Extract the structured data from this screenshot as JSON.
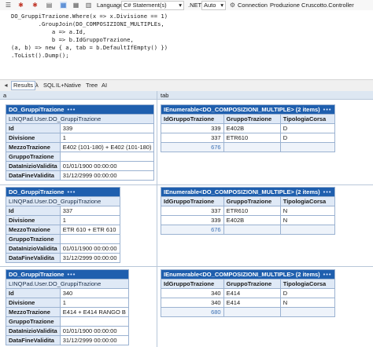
{
  "toolbar": {
    "language_label": "Language",
    "language_value": "C# Statement(s)",
    "dotnet_label": ".NET",
    "dotnet_value": "Auto",
    "connection_label": "Connection",
    "connection_value": "Produzione Cruscotto.Controller",
    "icons": [
      "bug-icon",
      "bug-icon",
      "grid-icon",
      "grid-icon",
      "grid-icon",
      "settings-icon"
    ]
  },
  "code_lines": [
    "DO_GruppiTrazione.Where(x => x.Divisione == 1)",
    "        .GroupJoin(DO_COMPOSIZIONI_MULTIPLEs,",
    "            a => a.Id,",
    "            b => b.IdGruppoTrazione,",
    "(a, b) => new { a, tab = b.DefaultIfEmpty() })",
    ".ToList().Dump();"
  ],
  "result_tabs": [
    "Results",
    "λ",
    "SQL",
    "IL+Native",
    "Tree",
    "AI"
  ],
  "grid": {
    "col_a": "a",
    "col_tab": "tab"
  },
  "rows": [
    {
      "a": {
        "caption": "DO_GruppiTrazione",
        "menu": "•••",
        "type": "LINQPad.User.DO_GruppiTrazione",
        "fields": [
          {
            "label": "Id",
            "value": "339"
          },
          {
            "label": "Divisione",
            "value": "1"
          },
          {
            "label": "MezzoTrazione",
            "value": "E402 (101-180) + E402 (101-180)"
          },
          {
            "label": "GruppoTrazione",
            "value": ""
          },
          {
            "label": "DataInizioValidita",
            "value": "01/01/1900 00:00:00"
          },
          {
            "label": "DataFineValidita",
            "value": "31/12/2999 00:00:00"
          }
        ]
      },
      "tab": {
        "caption": "IEnumerable<DO_COMPOSIZIONI_MULTIPLE> (2 items)",
        "menu": "•••",
        "columns": [
          "IdGruppoTrazione",
          "GruppoTrazione",
          "TipologiaCorsa"
        ],
        "items": [
          [
            "339",
            "E402B",
            "D"
          ],
          [
            "337",
            "ETR610",
            "D"
          ]
        ],
        "total": "676"
      }
    },
    {
      "a": {
        "caption": "DO_GruppiTrazione",
        "menu": "•••",
        "type": "LINQPad.User.DO_GruppiTrazione",
        "fields": [
          {
            "label": "Id",
            "value": "337"
          },
          {
            "label": "Divisione",
            "value": "1"
          },
          {
            "label": "MezzoTrazione",
            "value": "ETR 610 + ETR 610"
          },
          {
            "label": "GruppoTrazione",
            "value": ""
          },
          {
            "label": "DataInizioValidita",
            "value": "01/01/1900 00:00:00"
          },
          {
            "label": "DataFineValidita",
            "value": "31/12/2999 00:00:00"
          }
        ]
      },
      "tab": {
        "caption": "IEnumerable<DO_COMPOSIZIONI_MULTIPLE> (2 items)",
        "menu": "•••",
        "columns": [
          "IdGruppoTrazione",
          "GruppoTrazione",
          "TipologiaCorsa"
        ],
        "items": [
          [
            "337",
            "ETR610",
            "N"
          ],
          [
            "339",
            "E402B",
            "N"
          ]
        ],
        "total": "676"
      }
    },
    {
      "a": {
        "caption": "DO_GruppiTrazione",
        "menu": "•••",
        "type": "LINQPad.User.DO_GruppiTrazione",
        "fields": [
          {
            "label": "Id",
            "value": "340"
          },
          {
            "label": "Divisione",
            "value": "1"
          },
          {
            "label": "MezzoTrazione",
            "value": "E414 + E414 RANGO B"
          },
          {
            "label": "GruppoTrazione",
            "value": ""
          },
          {
            "label": "DataInizioValidita",
            "value": "01/01/1900 00:00:00"
          },
          {
            "label": "DataFineValidita",
            "value": "31/12/2999 00:00:00"
          }
        ]
      },
      "tab": {
        "caption": "IEnumerable<DO_COMPOSIZIONI_MULTIPLE> (2 items)",
        "menu": "•••",
        "columns": [
          "IdGruppoTrazione",
          "GruppoTrazione",
          "TipologiaCorsa"
        ],
        "items": [
          [
            "340",
            "E414",
            "D"
          ],
          [
            "340",
            "E414",
            "N"
          ]
        ],
        "total": "680"
      }
    }
  ]
}
